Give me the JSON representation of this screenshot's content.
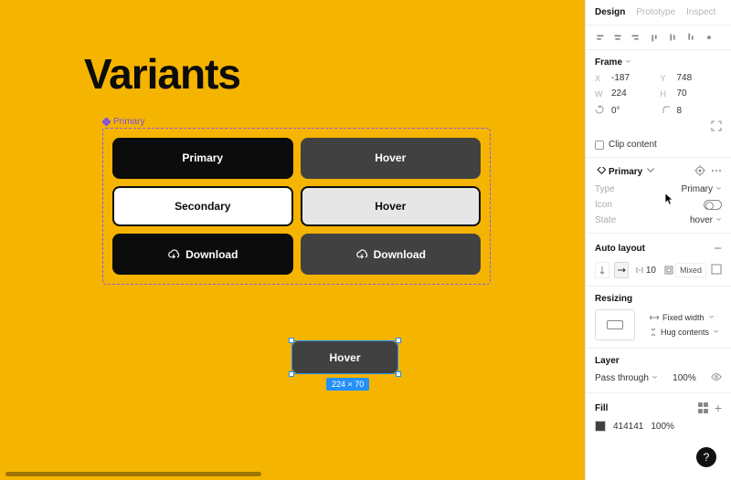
{
  "canvas": {
    "title": "Variants",
    "component_set_name": "Primary",
    "buttons": {
      "primary_default": "Primary",
      "primary_hover": "Hover",
      "secondary_default": "Secondary",
      "secondary_hover": "Hover",
      "download_default": "Download",
      "download_hover": "Download"
    },
    "selected_instance_label": "Hover",
    "selection_dimensions": "224 × 70"
  },
  "panel": {
    "tabs": {
      "design": "Design",
      "prototype": "Prototype",
      "inspect": "Inspect"
    },
    "frame": {
      "title": "Frame",
      "x_label": "X",
      "x": "-187",
      "y_label": "Y",
      "y": "748",
      "w_label": "W",
      "w": "224",
      "h_label": "H",
      "h": "70",
      "rotation": "0°",
      "corner": "8",
      "clip": "Clip content"
    },
    "component": {
      "name": "Primary",
      "props": {
        "type_label": "Type",
        "type_value": "Primary",
        "icon_label": "Icon",
        "state_label": "State",
        "state_value": "hover"
      }
    },
    "autolayout": {
      "title": "Auto layout",
      "gap": "10",
      "padding": "Mixed"
    },
    "resizing": {
      "title": "Resizing",
      "horizontal": "Fixed width",
      "vertical": "Hug contents"
    },
    "layer": {
      "title": "Layer",
      "blend": "Pass through",
      "opacity": "100%"
    },
    "fill": {
      "title": "Fill",
      "hex": "414141",
      "opacity": "100%"
    },
    "help": "?"
  }
}
